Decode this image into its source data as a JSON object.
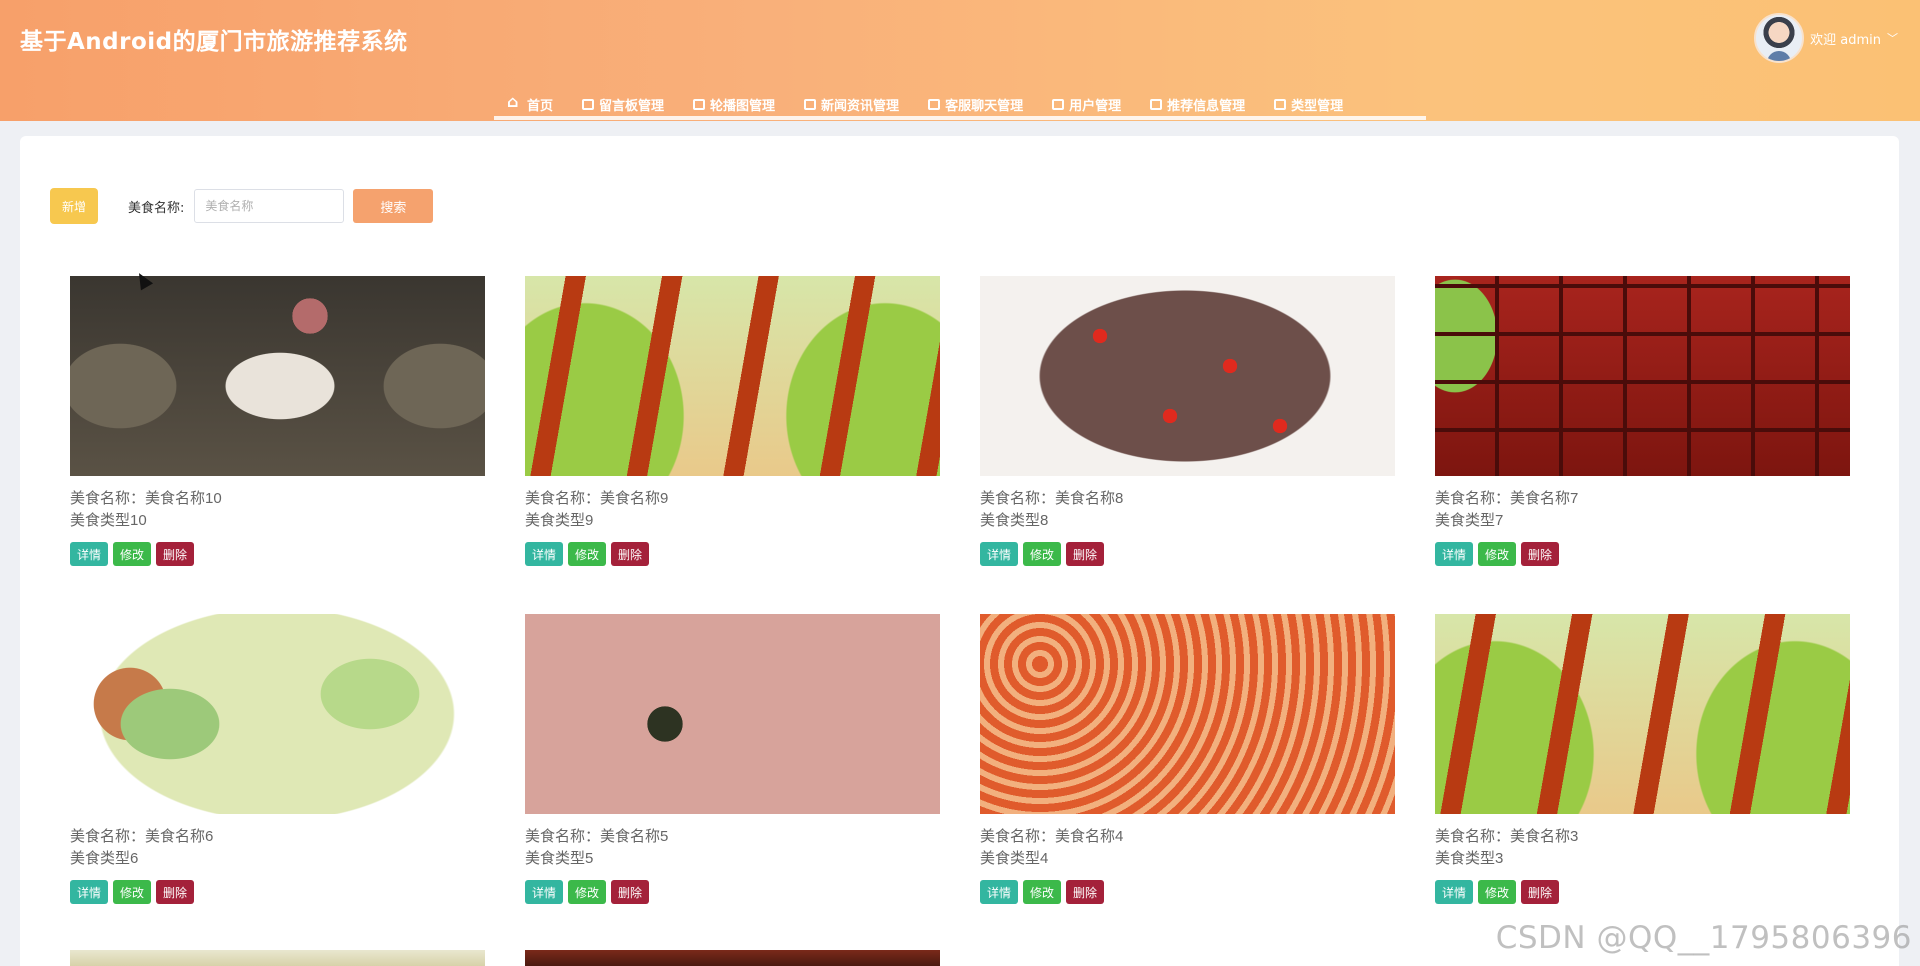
{
  "header": {
    "app_title": "基于Android的厦门市旅游推荐系统",
    "welcome": "欢迎 admin"
  },
  "nav": [
    {
      "label": "首页",
      "icon": "home-icon"
    },
    {
      "label": "留言板管理",
      "icon": "table-icon"
    },
    {
      "label": "轮播图管理",
      "icon": "image-icon"
    },
    {
      "label": "新闻资讯管理",
      "icon": "table-icon"
    },
    {
      "label": "客服聊天管理",
      "icon": "table-icon"
    },
    {
      "label": "用户管理",
      "icon": "lock-icon"
    },
    {
      "label": "推荐信息管理",
      "icon": "table-icon"
    },
    {
      "label": "类型管理",
      "icon": "table-icon"
    }
  ],
  "toolbar": {
    "add_label": "新增",
    "search_label": "美食名称:",
    "search_placeholder": "美食名称",
    "search_button": "搜索"
  },
  "actions": {
    "detail": "详情",
    "edit": "修改",
    "delete": "删除"
  },
  "cards": [
    {
      "name": "美食名称：美食名称10",
      "type": "美食类型10"
    },
    {
      "name": "美食名称：美食名称9",
      "type": "美食类型9"
    },
    {
      "name": "美食名称：美食名称8",
      "type": "美食类型8"
    },
    {
      "name": "美食名称：美食名称7",
      "type": "美食类型7"
    },
    {
      "name": "美食名称：美食名称6",
      "type": "美食类型6"
    },
    {
      "name": "美食名称：美食名称5",
      "type": "美食类型5"
    },
    {
      "name": "美食名称：美食名称4",
      "type": "美食类型4"
    },
    {
      "name": "美食名称：美食名称3",
      "type": "美食类型3"
    }
  ],
  "watermark": "CSDN @QQ__1795806396"
}
